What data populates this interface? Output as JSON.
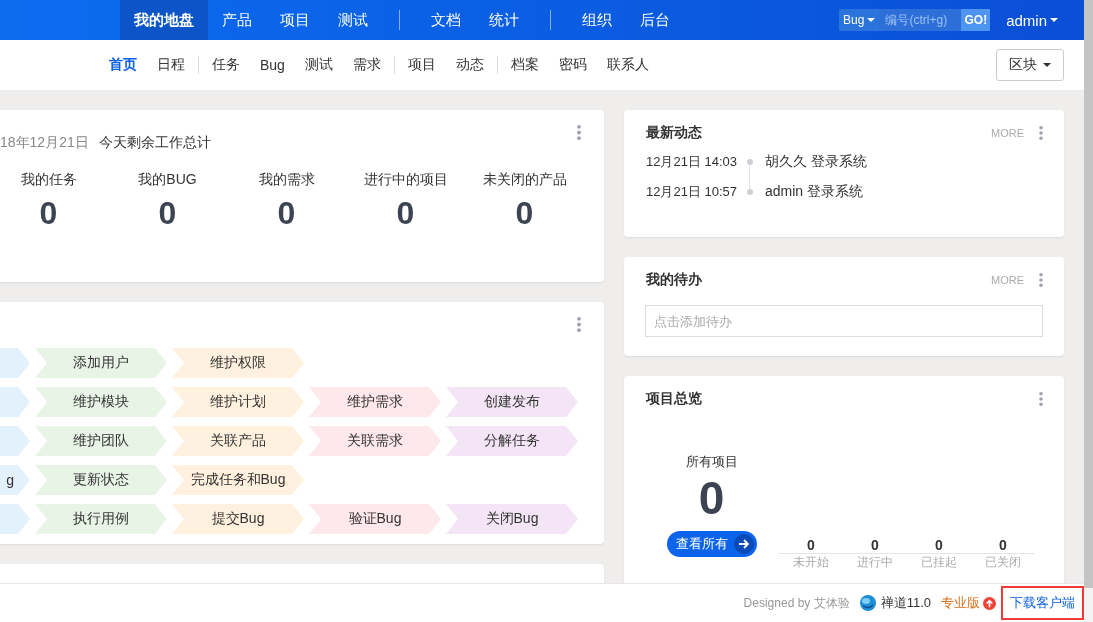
{
  "main_nav": {
    "groups": [
      [
        {
          "label": "我的地盘",
          "selected": true
        },
        {
          "label": "产品",
          "selected": false
        },
        {
          "label": "项目",
          "selected": false
        },
        {
          "label": "测试",
          "selected": false
        }
      ],
      [
        {
          "label": "文档",
          "selected": false
        },
        {
          "label": "统计",
          "selected": false
        }
      ],
      [
        {
          "label": "组织",
          "selected": false
        },
        {
          "label": "后台",
          "selected": false
        }
      ]
    ],
    "search": {
      "type": "Bug",
      "placeholder": "编号(ctrl+g)",
      "go": "GO!"
    },
    "user": "admin"
  },
  "sub_nav": {
    "groups": [
      [
        {
          "label": "首页",
          "selected": true
        },
        {
          "label": "日程",
          "selected": false
        }
      ],
      [
        {
          "label": "任务",
          "selected": false
        },
        {
          "label": "Bug",
          "selected": false
        },
        {
          "label": "测试",
          "selected": false
        },
        {
          "label": "需求",
          "selected": false
        }
      ],
      [
        {
          "label": "项目",
          "selected": false
        },
        {
          "label": "动态",
          "selected": false
        }
      ],
      [
        {
          "label": "档案",
          "selected": false
        },
        {
          "label": "密码",
          "selected": false
        },
        {
          "label": "联系人",
          "selected": false
        }
      ]
    ],
    "block_button": "区块"
  },
  "summary": {
    "date": "18年12月21日",
    "title": "今天剩余工作总计",
    "stats": [
      {
        "label": "我的任务",
        "value": "0"
      },
      {
        "label": "我的BUG",
        "value": "0"
      },
      {
        "label": "我的需求",
        "value": "0"
      },
      {
        "label": "进行中的项目",
        "value": "0"
      },
      {
        "label": "未关闭的产品",
        "value": "0"
      }
    ]
  },
  "flow": {
    "rows": [
      {
        "cells": [
          {
            "color": "#e3f1fd"
          },
          {
            "label": "添加用户",
            "color": "#e8f5e6"
          },
          {
            "label": "维护权限",
            "color": "#fff1dd"
          }
        ]
      },
      {
        "cells": [
          {
            "color": "#e3f1fd"
          },
          {
            "label": "维护模块",
            "color": "#e8f5e6"
          },
          {
            "label": "维护计划",
            "color": "#fff1dd"
          },
          {
            "label": "维护需求",
            "color": "#ffe8eb"
          },
          {
            "label": "创建发布",
            "color": "#f4e5f6"
          }
        ]
      },
      {
        "cells": [
          {
            "color": "#e3f1fd"
          },
          {
            "label": "维护团队",
            "color": "#e8f5e6"
          },
          {
            "label": "关联产品",
            "color": "#fff1dd"
          },
          {
            "label": "关联需求",
            "color": "#ffe8eb"
          },
          {
            "label": "分解任务",
            "color": "#f4e5f6"
          }
        ]
      },
      {
        "cells": [
          {
            "label": "g",
            "color": "#e3f1fd"
          },
          {
            "label": "更新状态",
            "color": "#e8f5e6"
          },
          {
            "label": "完成任务和Bug",
            "color": "#fff1dd"
          }
        ]
      },
      {
        "cells": [
          {
            "color": "#e3f1fd"
          },
          {
            "label": "执行用例",
            "color": "#e8f5e6"
          },
          {
            "label": "提交Bug",
            "color": "#fff1dd"
          },
          {
            "label": "验证Bug",
            "color": "#ffe8eb"
          },
          {
            "label": "关闭Bug",
            "color": "#f4e5f6"
          }
        ]
      }
    ]
  },
  "dynamics": {
    "title": "最新动态",
    "more": "MORE",
    "items": [
      {
        "time": "12月21日 14:03",
        "text": "胡久久 登录系统"
      },
      {
        "time": "12月21日 10:57",
        "text": "admin 登录系统"
      }
    ]
  },
  "todo": {
    "title": "我的待办",
    "more": "MORE",
    "placeholder": "点击添加待办"
  },
  "projects": {
    "title": "项目总览",
    "all_label": "所有项目",
    "all_value": "0",
    "view_all": "查看所有",
    "stats": [
      {
        "value": "0",
        "label": "未开始"
      },
      {
        "value": "0",
        "label": "进行中"
      },
      {
        "value": "0",
        "label": "已挂起"
      },
      {
        "value": "0",
        "label": "已关闭"
      }
    ]
  },
  "footer": {
    "designed_by": "Designed by 艾体验",
    "version": "禅道11.0",
    "edition": "专业版",
    "download": {
      "label": "下载客户端",
      "highlighted": true
    }
  }
}
